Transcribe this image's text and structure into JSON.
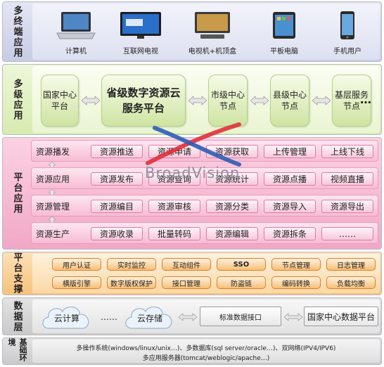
{
  "layers": {
    "multi_terminal": "多终端应用",
    "multi_level": "多级应用",
    "platform_app": "平台应用",
    "platform_support": "平台支撑",
    "data_layer": "数据层",
    "base_env": "基础环境"
  },
  "devices": [
    {
      "label": "计算机",
      "icon": "laptop-icon"
    },
    {
      "label": "互联网电视",
      "icon": "tv-icon"
    },
    {
      "label": "电视机+机顶盒",
      "icon": "tv-settop-icon"
    },
    {
      "label": "平板电脑",
      "icon": "tablet-icon"
    },
    {
      "label": "手机用户",
      "icon": "phone-icon"
    }
  ],
  "levels": [
    {
      "label": "国家中心平台"
    },
    {
      "label": "省级数字资源云服务平台"
    },
    {
      "label": "市级中心节点"
    },
    {
      "label": "县级中心节点"
    },
    {
      "label": "基层服务节点"
    }
  ],
  "levels_more": "…",
  "platform_rows": [
    {
      "label": "资源播发",
      "items": [
        "资源推送",
        "资源申请",
        "资源获取",
        "上传管理",
        "上线下线"
      ]
    },
    {
      "label": "资源应用",
      "items": [
        "资源发布",
        "资源查询",
        "资源统计",
        "资源点播",
        "视频直播"
      ]
    },
    {
      "label": "资源管理",
      "items": [
        "资源编目",
        "资源审核",
        "资源分类",
        "资源导入",
        "资源导出"
      ]
    },
    {
      "label": "资源生产",
      "items": [
        "资源收录",
        "批量转码",
        "资源编辑",
        "资源拆条",
        "……"
      ]
    }
  ],
  "support": [
    [
      "用户认证",
      "实时监控",
      "互动组件",
      "SSO",
      "节点管理",
      "日志管理"
    ],
    [
      "横版引擎",
      "数字版权保护",
      "接口管理",
      "防盗链",
      "编码转换",
      "负载均衡"
    ]
  ],
  "data": {
    "cloud_compute": "云计算",
    "dots": "……",
    "cloud_storage": "云存储",
    "interface": "标准数据接口",
    "national_db": "国家中心数据平台"
  },
  "base": {
    "line1": "多操作系统(windows/linux/unix…)、多数据库(sql server/oracle…)、双网络(IPV4/IPV6)",
    "line2": "多应用服务器(tomcat/weblogic/apache…)"
  },
  "watermark": "BroadVision",
  "colors": {
    "accent_red": "#e0303a",
    "accent_blue": "#2b5db5"
  }
}
